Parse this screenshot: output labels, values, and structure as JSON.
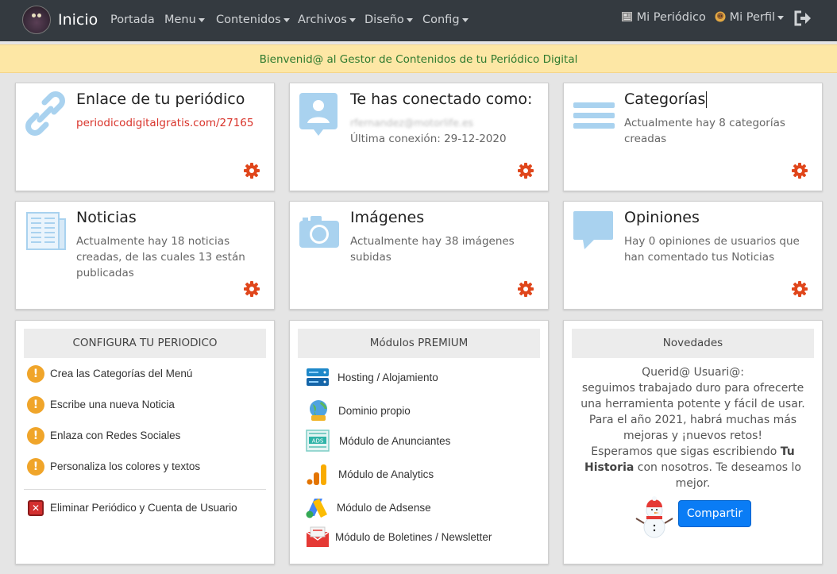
{
  "nav": {
    "brand": "Inicio",
    "items": [
      {
        "label": "Portada",
        "caret": false
      },
      {
        "label": "Menu",
        "caret": true
      },
      {
        "label": "Contenidos",
        "caret": true
      },
      {
        "label": "Archivos",
        "caret": true
      },
      {
        "label": "Diseño",
        "caret": true
      },
      {
        "label": "Config",
        "caret": true
      }
    ],
    "right": [
      {
        "label": "Mi Periódico",
        "icon": "newspaper-icon"
      },
      {
        "label": "Mi Perfil",
        "icon": "user-face-icon",
        "caret": true
      }
    ],
    "logout_icon": "logout-icon"
  },
  "banner": "Bienvenid@ al Gestor de Contenidos de tu Periódico Digital",
  "cards": [
    {
      "title": "Enlace de tu periódico",
      "text": "periodicodigitalgratis.com/27165",
      "icon": "chain-link-icon"
    },
    {
      "title": "Te has conectado como:",
      "email": "rfernandez@motorlife.es",
      "text": "Última conexión: 29-12-2020",
      "icon": "user-profile-icon"
    },
    {
      "title": "Categorías",
      "text": "Actualmente hay 8 categorías creadas",
      "icon": "menu-lines-icon"
    },
    {
      "title": "Noticias",
      "text": "Actualmente hay 18 noticias creadas, de las cuales 13 están publicadas",
      "icon": "newspaper-icon"
    },
    {
      "title": "Imágenes",
      "text": "Actualmente hay 38 imágenes subidas",
      "icon": "camera-icon"
    },
    {
      "title": "Opiniones",
      "text": "Hay 0 opiniones de usuarios que han comentado tus Noticias",
      "icon": "speech-bubble-icon"
    }
  ],
  "config_panel": {
    "header": "CONFIGURA TU PERIODICO",
    "items": [
      "Crea las Categorías del Menú",
      "Escribe una nueva Noticia",
      "Enlaza con Redes Sociales",
      "Personaliza los colores y textos"
    ],
    "delete": "Eliminar Periódico y Cuenta de Usuario"
  },
  "premium_panel": {
    "header": "Módulos PREMIUM",
    "items": [
      {
        "label": "Hosting / Alojamiento",
        "icon": "server-icon"
      },
      {
        "label": "Dominio propio",
        "icon": "globe-icon"
      },
      {
        "label": "Módulo de Anunciantes",
        "icon": "ads-icon"
      },
      {
        "label": "Módulo de Analytics",
        "icon": "analytics-icon"
      },
      {
        "label": "Módulo de Adsense",
        "icon": "adsense-icon"
      },
      {
        "label": "Módulo de Boletines / Newsletter",
        "icon": "envelope-icon"
      }
    ]
  },
  "news_panel": {
    "header": "Novedades",
    "greeting": "Querid@ Usuari@:",
    "body": "seguimos trabajado duro para ofrecerte una herramienta potente y fácil de usar. Para el año 2021, habrá muchas más mejoras y ¡nuevos retos!",
    "closing_pre": "Esperamos que sigas escribiendo",
    "closing_bold": "Tu Historia",
    "closing_post": "con nosotros. Te deseamos lo mejor.",
    "share_label": "Compartir"
  },
  "colors": {
    "nav_bg": "#343a40",
    "banner_bg": "#fde7a5",
    "gear": "#e0461b",
    "link": "#d9342b",
    "share_bg": "#0a7cf5"
  }
}
